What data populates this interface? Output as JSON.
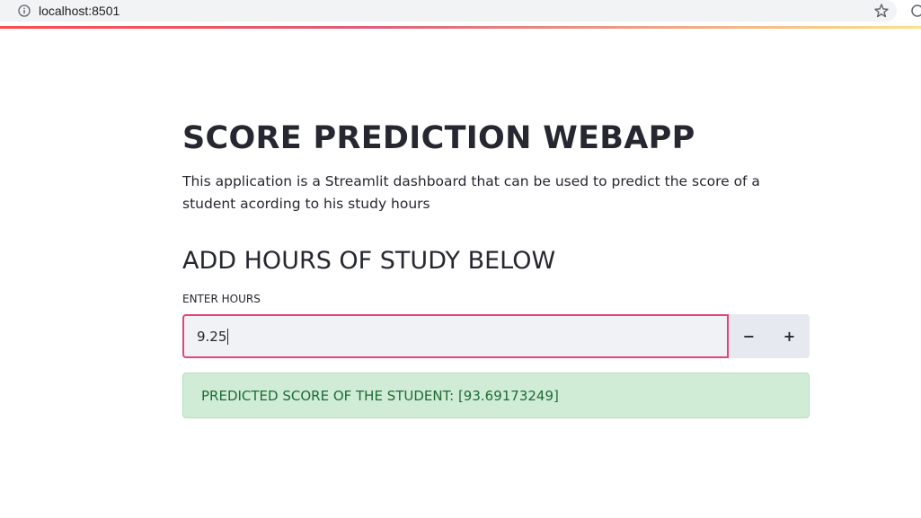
{
  "browser": {
    "url": "localhost:8501",
    "icons": [
      "info-icon",
      "star-icon",
      "profile-icon"
    ]
  },
  "header": {
    "title": "SCORE PREDICTION WEBAPP",
    "description": "This application is a Streamlit dashboard that can be used to predict the score of a student acording to his study hours"
  },
  "form": {
    "section_heading": "ADD HOURS OF STUDY BELOW",
    "hours_label": "ENTER HOURS",
    "hours_value": "9.25",
    "decrement_label": "−",
    "increment_label": "+"
  },
  "result": {
    "text": "PREDICTED SCORE OF THE STUDENT: [93.69173249]"
  },
  "colors": {
    "accent": "#e0457b",
    "success_bg": "#d0ecd6",
    "success_text": "#1d6b35",
    "input_bg": "#f0f2f6"
  }
}
